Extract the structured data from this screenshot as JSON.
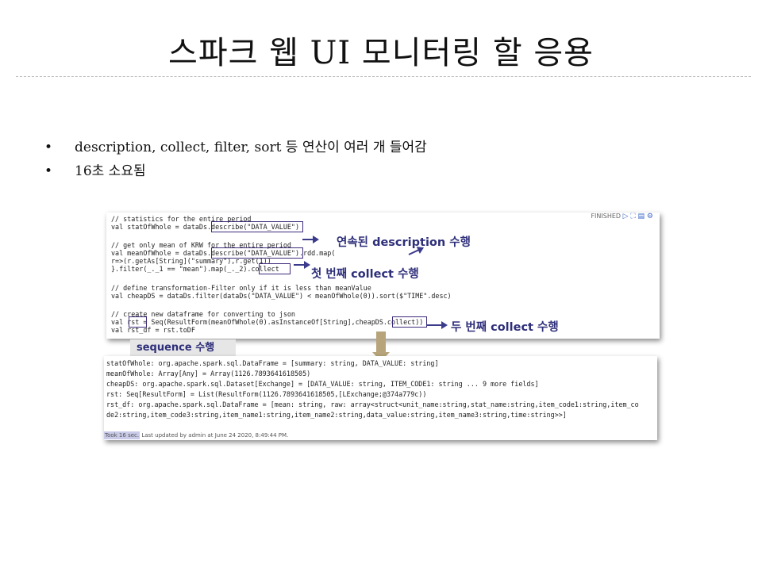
{
  "slide": {
    "title": "스파크 웹 UI 모니터링 할 응용",
    "bullets": [
      {
        "marker": "•",
        "text": "description, collect, filter, sort 등 연산이 여러 개 들어감"
      },
      {
        "marker": "•",
        "text": "16초 소요됨"
      }
    ]
  },
  "code_panel": {
    "status": "FINISHED",
    "status_icons": "▷ ⛶ ▤ ⚙",
    "lines": [
      "// statistics for the entire period",
      "val statOfWhole = dataDs.describe(\"DATA_VALUE\")",
      "",
      "// get only mean of KRW for the entire period",
      "val meanOfWhole = dataDs.describe(\"DATA_VALUE\").rdd.map(",
      "r=>(r.getAs[String](\"summary\"),r.get(1))",
      "}.filter(_._1 == \"mean\").map(_._2).collect",
      "",
      "// define transformation-Filter only if it is less than meanValue",
      "val cheapDS = dataDs.filter(dataDs(\"DATA_VALUE\") < meanOfWhole(0)).sort($\"TIME\".desc)",
      "",
      "// create new dataframe for converting to json",
      "val rst = Seq(ResultForm(meanOfWhole(0).asInstanceOf[String],cheapDS.collect))",
      "val rst_df = rst.toDF"
    ]
  },
  "callouts": {
    "description": "연속된 description 수행",
    "collect1": "첫 번째 collect 수행",
    "collect2": "두 번째 collect 수행",
    "sequence": "sequence 수행"
  },
  "output_panel": {
    "lines": [
      "statOfWhole: org.apache.spark.sql.DataFrame = [summary: string, DATA_VALUE: string]",
      "meanOfWhole: Array[Any] = Array(1126.7893641618505)",
      "cheapDS: org.apache.spark.sql.Dataset[Exchange] = [DATA_VALUE: string, ITEM_CODE1: string ... 9 more fields]",
      "rst: Seq[ResultForm] = List(ResultForm(1126.7893641618505,[LExchange;@374a779c))",
      "rst_df: org.apache.spark.sql.DataFrame = [mean: string, raw: array<struct<unit_name:string,stat_name:string,item_code1:string,item_co",
      "de2:string,item_code3:string,item_name1:string,item_name2:string,data_value:string,item_name3:string,time:string>>]"
    ],
    "took": "Took 16 sec.",
    "updated": "Last updated by admin at June 24 2020, 8:49:44 PM."
  }
}
